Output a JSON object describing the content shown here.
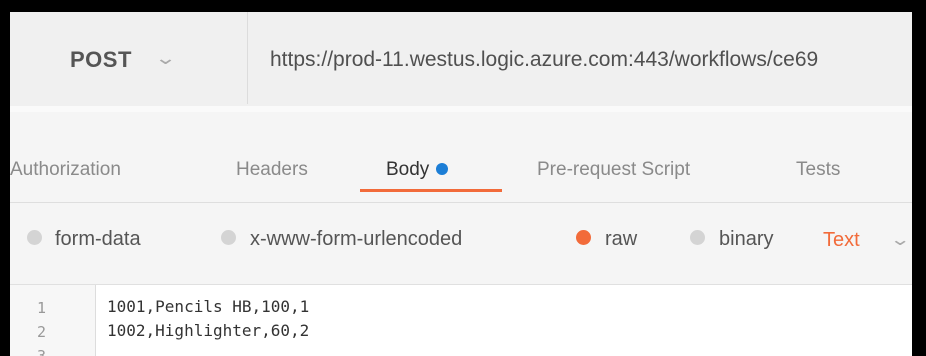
{
  "request": {
    "method": "POST",
    "url": "https://prod-11.westus.logic.azure.com:443/workflows/ce69"
  },
  "tabs": [
    {
      "label": "Authorization"
    },
    {
      "label": "Headers"
    },
    {
      "label": "Body",
      "active": true,
      "indicator": "blue-dot"
    },
    {
      "label": "Pre-request Script"
    },
    {
      "label": "Tests"
    }
  ],
  "body_modes": {
    "options": [
      "form-data",
      "x-www-form-urlencoded",
      "raw",
      "binary"
    ],
    "selected": "raw",
    "language": "Text"
  },
  "editor": {
    "line_numbers": [
      "1",
      "2",
      "3"
    ],
    "lines": [
      "1001,Pencils HB,100,1",
      "1002,Highlighter,60,2",
      ""
    ]
  },
  "colors": {
    "accent": "#f26b3a",
    "tab_dot": "#1c7ed6"
  }
}
